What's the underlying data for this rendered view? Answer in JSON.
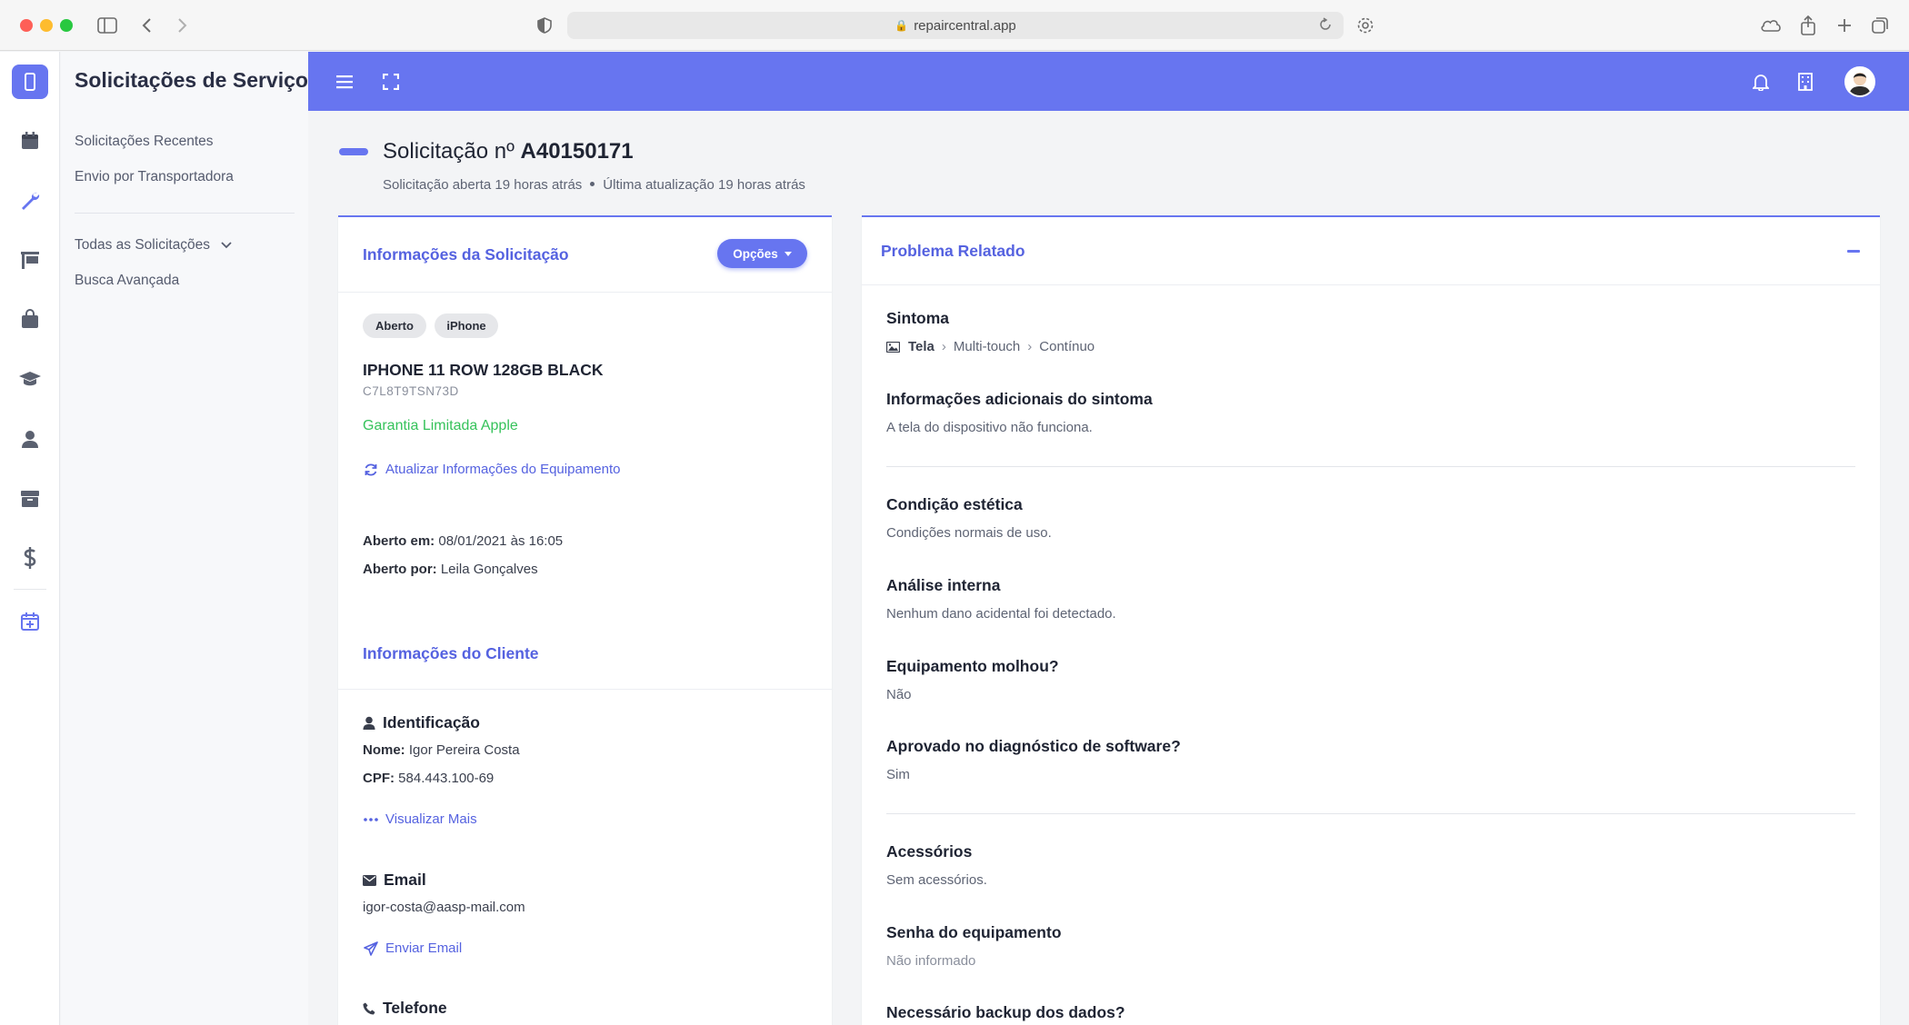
{
  "browser": {
    "url": "repaircentral.app"
  },
  "sidebar": {
    "title": "Solicitações de Serviço",
    "links": [
      "Solicitações Recentes",
      "Envio por Transportadora"
    ],
    "all_requests": "Todas as Solicitações",
    "advanced_search": "Busca Avançada"
  },
  "header": {
    "title_prefix": "Solicitação nº",
    "request_id": "A40150171",
    "opened_ago": "Solicitação aberta 19 horas atrás",
    "updated_ago": "Última atualização 19 horas atrás"
  },
  "request_info": {
    "heading": "Informações da Solicitação",
    "options_label": "Opções",
    "badges": [
      "Aberto",
      "iPhone"
    ],
    "device_name": "IPHONE 11 ROW 128GB BLACK",
    "serial": "C7L8T9TSN73D",
    "warranty": "Garantia Limitada Apple",
    "update_link": "Atualizar Informações do Equipamento",
    "opened_on_label": "Aberto em:",
    "opened_on_value": "08/01/2021 às 16:05",
    "opened_by_label": "Aberto por:",
    "opened_by_value": "Leila Gonçalves"
  },
  "customer": {
    "heading": "Informações do Cliente",
    "id_title": "Identificação",
    "name_label": "Nome:",
    "name_value": "Igor Pereira Costa",
    "cpf_label": "CPF:",
    "cpf_value": "584.443.100-69",
    "view_more": "Visualizar Mais",
    "email_title": "Email",
    "email_value": "igor-costa@aasp-mail.com",
    "send_email": "Enviar Email",
    "phone_title": "Telefone"
  },
  "problem": {
    "heading": "Problema Relatado",
    "symptom_label": "Sintoma",
    "symptom_path": [
      "Tela",
      "Multi-touch",
      "Contínuo"
    ],
    "fields": [
      {
        "label": "Informações adicionais do sintoma",
        "value": "A tela do dispositivo não funciona."
      },
      {
        "label": "Condição estética",
        "value": "Condições normais de uso."
      },
      {
        "label": "Análise interna",
        "value": "Nenhum dano acidental foi detectado."
      },
      {
        "label": "Equipamento molhou?",
        "value": "Não"
      },
      {
        "label": "Aprovado no diagnóstico de software?",
        "value": "Sim"
      },
      {
        "label": "Acessórios",
        "value": "Sem acessórios."
      },
      {
        "label": "Senha do equipamento",
        "value": "Não informado"
      },
      {
        "label": "Necessário backup dos dados?",
        "value": ""
      }
    ]
  },
  "colors": {
    "accent": "#6775f0",
    "link": "#5562e0",
    "success": "#35c25a"
  },
  "icons": {
    "rail": [
      "device-icon",
      "calendar-icon",
      "wrench-icon",
      "flag-icon",
      "bag-icon",
      "graduation-cap-icon",
      "user-icon",
      "box-icon",
      "dollar-icon",
      "calendar-plus-icon"
    ],
    "topbar": [
      "menu-icon",
      "fullscreen-icon",
      "bell-icon",
      "building-icon",
      "avatar"
    ]
  }
}
